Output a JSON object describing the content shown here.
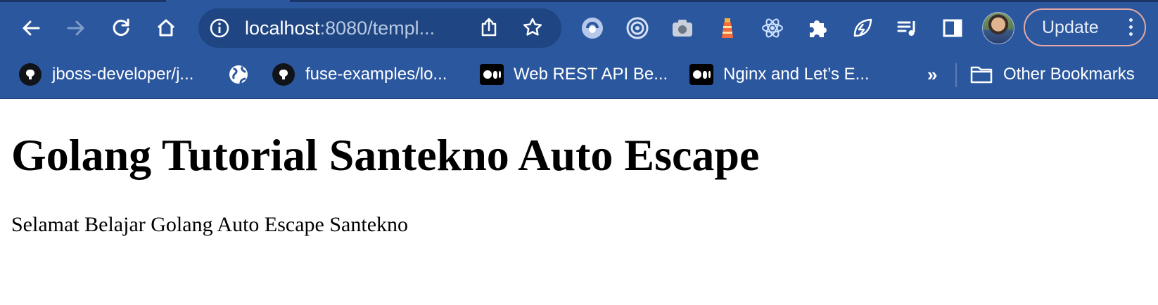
{
  "browser": {
    "address_bar": {
      "host": "localhost",
      "path_truncated": ":8080/templ...",
      "info_icon": "info-icon",
      "share_icon": "share-icon",
      "bookmark_star_icon": "star-icon"
    },
    "navigation": {
      "back_icon": "arrow-left-icon",
      "forward_icon": "arrow-right-icon",
      "reload_icon": "reload-icon",
      "home_icon": "home-icon"
    },
    "extensions": [
      "swirl-extension-icon",
      "target-extension-icon",
      "camera-extension-icon",
      "lighthouse-extension-icon",
      "react-extension-icon",
      "puzzle-extension-icon",
      "leaf-extension-icon",
      "media-queue-icon",
      "side-panel-icon"
    ],
    "update_button": {
      "label": "Update"
    },
    "bookmarks": [
      {
        "label": "jboss-developer/j...",
        "icon": "github-icon"
      },
      {
        "label": "",
        "icon": "globe-icon"
      },
      {
        "label": "fuse-examples/lo...",
        "icon": "github-icon"
      },
      {
        "label": "Web REST API Be...",
        "icon": "medium-icon"
      },
      {
        "label": "Nginx and Let’s E...",
        "icon": "medium-icon"
      }
    ],
    "overflow_chevron": "»",
    "other_bookmarks": {
      "label": "Other Bookmarks",
      "icon": "folder-icon"
    },
    "colors": {
      "toolbar": "#2b579f",
      "omnibox": "#1f4683",
      "update_border": "#e4a8a4"
    }
  },
  "page": {
    "heading": "Golang Tutorial Santekno Auto Escape",
    "paragraph": "Selamat Belajar Golang Auto Escape Santekno"
  }
}
